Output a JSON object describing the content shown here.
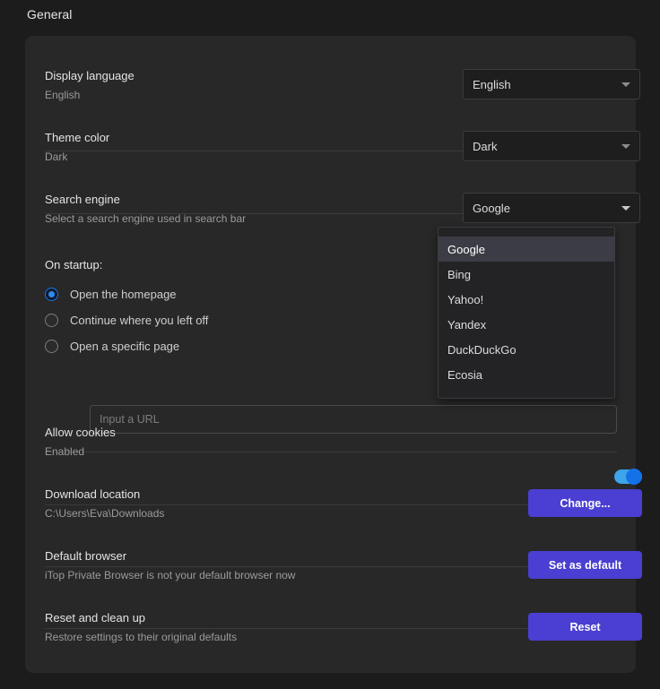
{
  "page": {
    "title": "General"
  },
  "settings": {
    "display_language": {
      "label": "Display language",
      "sub": "English",
      "value": "English"
    },
    "theme_color": {
      "label": "Theme color",
      "sub": "Dark",
      "value": "Dark"
    },
    "search_engine": {
      "label": "Search engine",
      "sub": "Select a search engine used in search bar",
      "value": "Google",
      "options": [
        "Google",
        "Bing",
        "Yahoo!",
        "Yandex",
        "DuckDuckGo",
        "Ecosia"
      ],
      "selected_index": 0
    },
    "on_startup": {
      "label": "On startup:",
      "options": [
        {
          "label": "Open the homepage",
          "checked": true
        },
        {
          "label": "Continue where you left off",
          "checked": false
        },
        {
          "label": "Open a specific page",
          "checked": false
        }
      ],
      "url_input": {
        "placeholder": "Input a URL",
        "value": ""
      }
    },
    "allow_cookies": {
      "label": "Allow cookies",
      "sub": "Enabled",
      "enabled": true
    },
    "download_location": {
      "label": "Download location",
      "sub": "C:\\Users\\Eva\\Downloads",
      "button": "Change..."
    },
    "default_browser": {
      "label": "Default browser",
      "sub": "iTop Private Browser is not your default browser now",
      "button": "Set as default"
    },
    "reset": {
      "label": "Reset and clean up",
      "sub": "Restore settings to their original defaults",
      "button": "Reset"
    }
  },
  "colors": {
    "page_bg": "#1c1c1c",
    "card_bg": "#282828",
    "accent_button": "#4a3fd2",
    "toggle_track": "#3da5ea",
    "toggle_knob": "#1471e8",
    "radio_accent": "#2b8cf0"
  }
}
